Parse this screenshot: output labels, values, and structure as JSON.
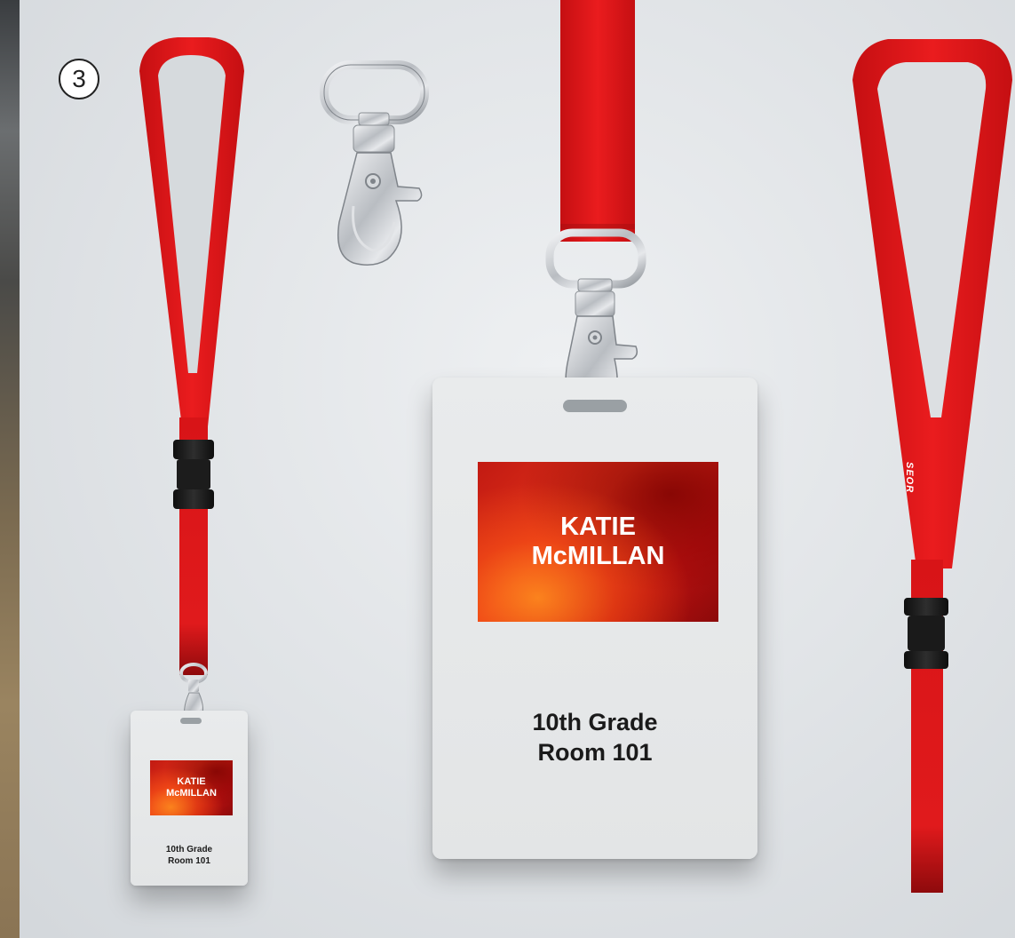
{
  "step_number": "3",
  "badge": {
    "name": "KATIE",
    "surname": "McMILLAN",
    "grade": "10th Grade",
    "room": "Room 101"
  },
  "strap_brand_text": "SEOR",
  "colors": {
    "lanyard_red": "#e0181a",
    "banner_red": "#d4221a",
    "banner_orange": "#ff7a1e",
    "card_white": "#e7e9ea",
    "buckle_black": "#1c1c1c",
    "metal": "#c9ccd0"
  }
}
